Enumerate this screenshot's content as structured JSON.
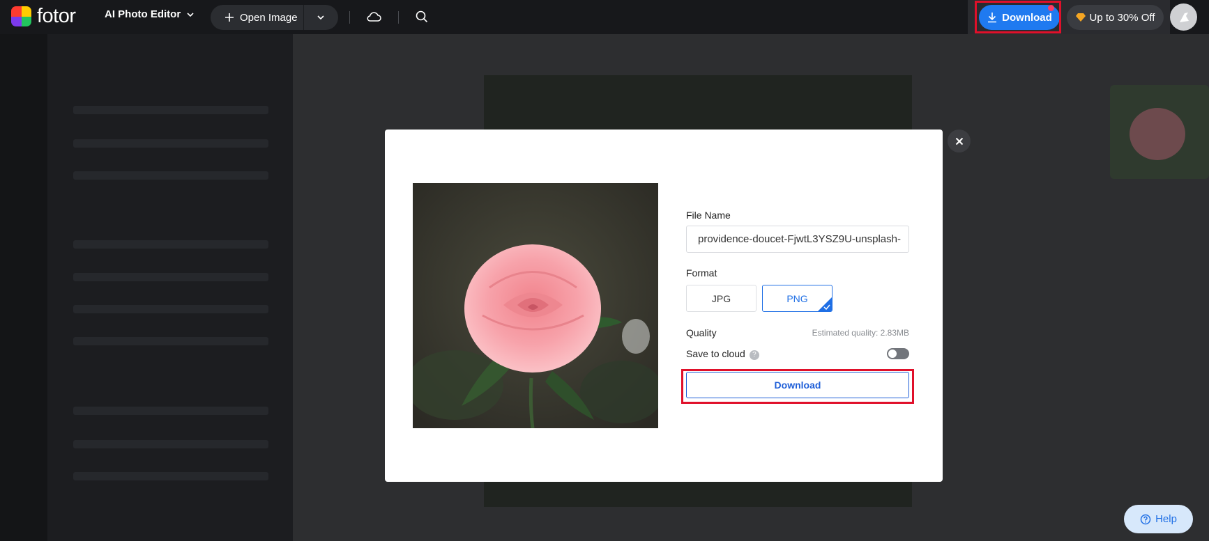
{
  "app": {
    "logo_text": "fotor",
    "editor_menu_label": "AI Photo Editor",
    "open_image_label": "Open Image",
    "download_label": "Download",
    "promo_label": "Up to 30% Off",
    "help_label": "Help"
  },
  "dialog": {
    "file_name_label": "File Name",
    "file_name_value": "providence-doucet-FjwtL3YSZ9U-unsplash-",
    "format_label": "Format",
    "formats": [
      "JPG",
      "PNG"
    ],
    "selected_format": "PNG",
    "quality_label": "Quality",
    "estimated_quality": "Estimated quality: 2.83MB",
    "save_to_cloud_label": "Save to cloud",
    "save_to_cloud_enabled": false,
    "download_label": "Download"
  },
  "colors": {
    "accent": "#1f7af0",
    "highlight": "#e0102a"
  }
}
